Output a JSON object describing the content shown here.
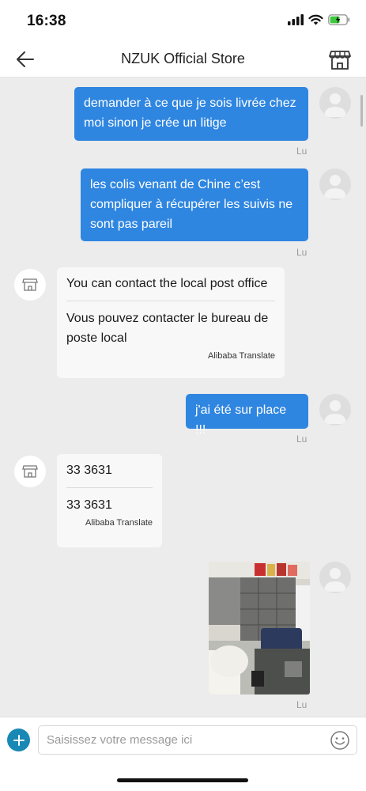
{
  "status_bar": {
    "time": "16:38"
  },
  "header": {
    "title": "NZUK Official Store"
  },
  "messages": {
    "m1": {
      "text": "demander à ce que je sois livrée chez moi sinon je crée un litige",
      "status": "Lu"
    },
    "m2": {
      "text": "les colis venant de Chine c’est compliquer à récupérer les suivis ne sont pas pareil",
      "status": "Lu"
    },
    "m3": {
      "original": "You can contact the local post office",
      "translated": "Vous pouvez contacter le bureau de poste local",
      "translate_label": "Alibaba Translate"
    },
    "m4": {
      "text": "j'ai été sur place !!!",
      "status": "Lu"
    },
    "m5": {
      "original": "33 3631",
      "translated": "33 3631",
      "translate_label": "Alibaba Translate"
    },
    "m6": {
      "status": "Lu"
    }
  },
  "input": {
    "placeholder": "Saisissez votre message ici"
  },
  "colors": {
    "outgoing_bubble": "#2f86e0",
    "chat_background": "#ececec",
    "add_button": "#1a88b5",
    "battery": "#3ec93e"
  },
  "icons": [
    "back-arrow-icon",
    "store-icon",
    "user-avatar-icon",
    "add-icon",
    "emoji-icon",
    "signal-icon",
    "wifi-icon",
    "battery-icon"
  ]
}
